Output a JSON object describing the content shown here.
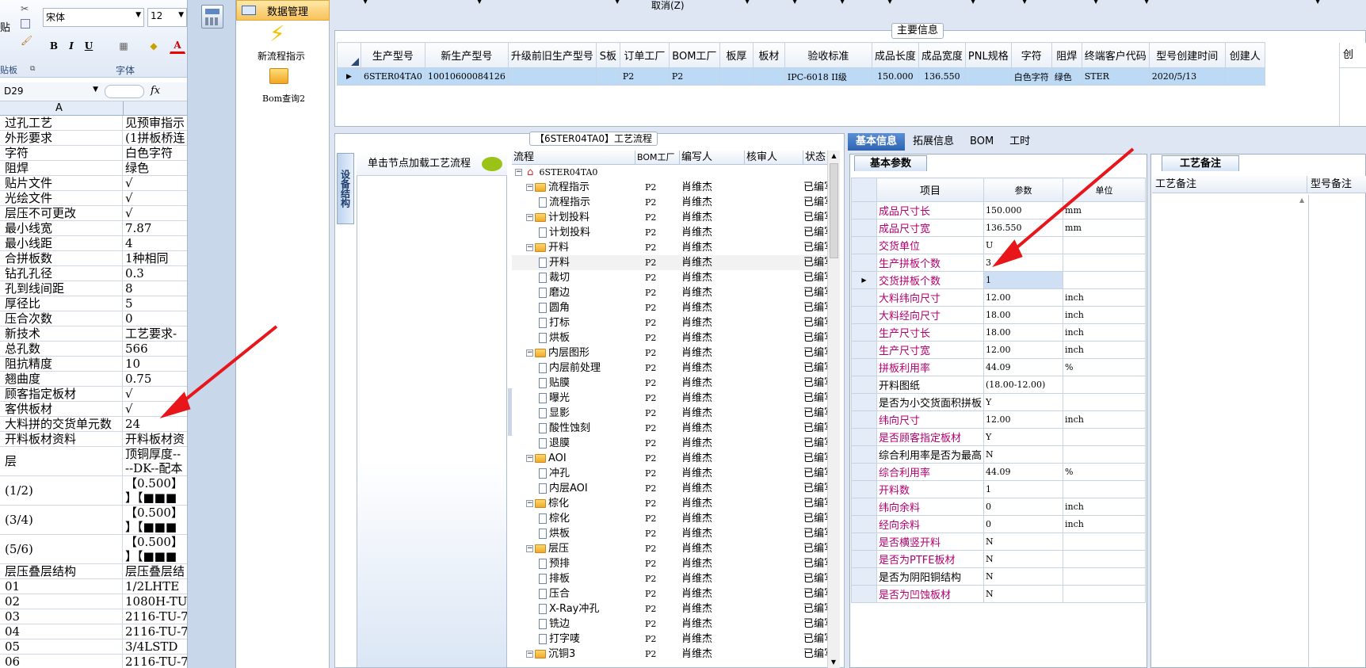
{
  "excel": {
    "font_name": "宋体",
    "font_size": "12",
    "clipboard_paste": "贴",
    "clipboard_label": "贴板",
    "font_group_label": "字体",
    "cell_ref": "D29",
    "fx": "fx",
    "column_a": "A",
    "rows": [
      {
        "a": "过孔工艺",
        "b": "见预审指示"
      },
      {
        "a": "外形要求",
        "b": "(1拼板桥连"
      },
      {
        "a": "字符",
        "b": "白色字符"
      },
      {
        "a": "阻焊",
        "b": "绿色"
      },
      {
        "a": "贴片文件",
        "b": "√"
      },
      {
        "a": "光绘文件",
        "b": "√"
      },
      {
        "a": "层压不可更改",
        "b": "√"
      },
      {
        "a": "最小线宽",
        "b": "7.87"
      },
      {
        "a": "最小线距",
        "b": "4"
      },
      {
        "a": "合拼板数",
        "b": "1种相同"
      },
      {
        "a": "钻孔孔径",
        "b": "0.3"
      },
      {
        "a": "孔到线间距",
        "b": "8"
      },
      {
        "a": "厚径比",
        "b": "5"
      },
      {
        "a": "压合次数",
        "b": "0"
      },
      {
        "a": "新技术",
        "b": "工艺要求-"
      },
      {
        "a": "总孔数",
        "b": "566"
      },
      {
        "a": "阻抗精度",
        "b": "10"
      },
      {
        "a": "翘曲度",
        "b": "0.75"
      },
      {
        "a": "顾客指定板材",
        "b": "√"
      },
      {
        "a": "客供板材",
        "b": "√"
      },
      {
        "a": "大料拼的交货单元数",
        "b": "24"
      },
      {
        "a": "开料板材资料",
        "b": "开料板材资"
      }
    ],
    "tall_rows": [
      {
        "a": "层",
        "b1": "顶铜厚度--",
        "b2": "--DK--配本"
      },
      {
        "a": "(1/2)",
        "b1": "【0.500】",
        "b2": "】【■■■"
      },
      {
        "a": "(3/4)",
        "b1": "【0.500】",
        "b2": "】【■■■"
      },
      {
        "a": "(5/6)",
        "b1": "【0.500】",
        "b2": "】【■■■"
      }
    ],
    "rows2": [
      {
        "a": "层压叠层结构",
        "b": "层压叠层结"
      },
      {
        "a": "01",
        "b": "1/2LHTE"
      },
      {
        "a": "02",
        "b": "1080H-TU-7"
      },
      {
        "a": "03",
        "b": "2116-TU-76"
      },
      {
        "a": "04",
        "b": "2116-TU-76"
      },
      {
        "a": "05",
        "b": "3/4LSTD"
      },
      {
        "a": "06",
        "b": "2116-TU-76"
      }
    ]
  },
  "nav": {
    "tab_label": "数据管理",
    "items": [
      {
        "label": "新流程指示"
      },
      {
        "label": "Bom查询2"
      }
    ]
  },
  "toolbar": {
    "cancel": "取消(Z)"
  },
  "main_info": {
    "title": "主要信息",
    "columns": [
      "生产型号",
      "新生产型号",
      "升级前旧生产型号",
      "S板",
      "订单工厂",
      "BOM工厂",
      "板厚",
      "板材",
      "验收标准",
      "成品长度",
      "成品宽度",
      "PNL规格",
      "字符",
      "阻焊",
      "终端客户代码",
      "型号创建时间",
      "创建人"
    ],
    "row": [
      "6STER04TA0",
      "10010600084126",
      "",
      "",
      "P2",
      "P2",
      "",
      "",
      "IPC-6018 II级",
      "150.000",
      "136.550",
      "",
      "白色字符",
      "绿色",
      "STER",
      "2020/5/13",
      ""
    ],
    "extra_col": "创"
  },
  "flow": {
    "title": "【6STER04TA0】工艺流程",
    "vtab": "设备结构",
    "hint": "单击节点加载工艺流程",
    "columns": [
      "流程",
      "BOM工厂",
      "编写人",
      "核审人",
      "状态"
    ],
    "root": "6STER04TA0",
    "rows": [
      {
        "name": "流程指示",
        "kind": "folder",
        "f": "P2",
        "w": "肖维杰",
        "s": "已编写"
      },
      {
        "name": "流程指示",
        "kind": "doc",
        "f": "P2",
        "w": "肖维杰",
        "s": "已编写"
      },
      {
        "name": "计划投料",
        "kind": "folder",
        "f": "P2",
        "w": "肖维杰",
        "s": "已编写"
      },
      {
        "name": "计划投料",
        "kind": "doc",
        "f": "P2",
        "w": "肖维杰",
        "s": "已编写"
      },
      {
        "name": "开料",
        "kind": "folder",
        "f": "P2",
        "w": "肖维杰",
        "s": "已编写"
      },
      {
        "name": "开料",
        "kind": "doc",
        "f": "P2",
        "w": "肖维杰",
        "s": "已编写",
        "hl": true
      },
      {
        "name": "裁切",
        "kind": "doc",
        "f": "P2",
        "w": "肖维杰",
        "s": "已编写"
      },
      {
        "name": "磨边",
        "kind": "doc",
        "f": "P2",
        "w": "肖维杰",
        "s": "已编写"
      },
      {
        "name": "圆角",
        "kind": "doc",
        "f": "P2",
        "w": "肖维杰",
        "s": "已编写"
      },
      {
        "name": "打标",
        "kind": "doc",
        "f": "P2",
        "w": "肖维杰",
        "s": "已编写"
      },
      {
        "name": "烘板",
        "kind": "doc",
        "f": "P2",
        "w": "肖维杰",
        "s": "已编写"
      },
      {
        "name": "内层图形",
        "kind": "folder",
        "f": "P2",
        "w": "肖维杰",
        "s": "已编写"
      },
      {
        "name": "内层前处理",
        "kind": "doc",
        "f": "P2",
        "w": "肖维杰",
        "s": "已编写"
      },
      {
        "name": "贴膜",
        "kind": "doc",
        "f": "P2",
        "w": "肖维杰",
        "s": "已编写"
      },
      {
        "name": "曝光",
        "kind": "doc",
        "f": "P2",
        "w": "肖维杰",
        "s": "已编写"
      },
      {
        "name": "显影",
        "kind": "doc",
        "f": "P2",
        "w": "肖维杰",
        "s": "已编写"
      },
      {
        "name": "酸性蚀刻",
        "kind": "doc",
        "f": "P2",
        "w": "肖维杰",
        "s": "已编写"
      },
      {
        "name": "退膜",
        "kind": "doc",
        "f": "P2",
        "w": "肖维杰",
        "s": "已编写"
      },
      {
        "name": "AOI",
        "kind": "folder",
        "f": "P2",
        "w": "肖维杰",
        "s": "已编写"
      },
      {
        "name": "冲孔",
        "kind": "doc",
        "f": "P2",
        "w": "肖维杰",
        "s": "已编写"
      },
      {
        "name": "内层AOI",
        "kind": "doc",
        "f": "P2",
        "w": "肖维杰",
        "s": "已编写"
      },
      {
        "name": "棕化",
        "kind": "folder",
        "f": "P2",
        "w": "肖维杰",
        "s": "已编写"
      },
      {
        "name": "棕化",
        "kind": "doc",
        "f": "P2",
        "w": "肖维杰",
        "s": "已编写"
      },
      {
        "name": "烘板",
        "kind": "doc",
        "f": "P2",
        "w": "肖维杰",
        "s": "已编写"
      },
      {
        "name": "层压",
        "kind": "folder",
        "f": "P2",
        "w": "肖维杰",
        "s": "已编写"
      },
      {
        "name": "预排",
        "kind": "doc",
        "f": "P2",
        "w": "肖维杰",
        "s": "已编写"
      },
      {
        "name": "排板",
        "kind": "doc",
        "f": "P2",
        "w": "肖维杰",
        "s": "已编写"
      },
      {
        "name": "压合",
        "kind": "doc",
        "f": "P2",
        "w": "肖维杰",
        "s": "已编写"
      },
      {
        "name": "X-Ray冲孔",
        "kind": "doc",
        "f": "P2",
        "w": "肖维杰",
        "s": "已编写"
      },
      {
        "name": "铣边",
        "kind": "doc",
        "f": "P2",
        "w": "肖维杰",
        "s": "已编写"
      },
      {
        "name": "打字唛",
        "kind": "doc",
        "f": "P2",
        "w": "肖维杰",
        "s": "已编写"
      },
      {
        "name": "沉铜3",
        "kind": "folder",
        "f": "P2",
        "w": "肖维杰",
        "s": "已编写"
      }
    ]
  },
  "right_tabs": [
    "基本信息",
    "拓展信息",
    "BOM",
    "工时"
  ],
  "basic": {
    "tab": "基本参数",
    "columns": [
      "项目",
      "参数",
      "单位"
    ],
    "rows": [
      {
        "item": "成品尺寸长",
        "val": "150.000",
        "unit": "mm",
        "pink": true
      },
      {
        "item": "成品尺寸宽",
        "val": "136.550",
        "unit": "mm",
        "pink": true
      },
      {
        "item": "交货单位",
        "val": "U",
        "unit": "",
        "pink": true
      },
      {
        "item": "生产拼板个数",
        "val": "3",
        "unit": "",
        "pink": true
      },
      {
        "item": "交货拼板个数",
        "val": "1",
        "unit": "",
        "pink": true,
        "cur": true
      },
      {
        "item": "大料纬向尺寸",
        "val": "12.00",
        "unit": "inch",
        "pink": true
      },
      {
        "item": "大料经向尺寸",
        "val": "18.00",
        "unit": "inch",
        "pink": true
      },
      {
        "item": "生产尺寸长",
        "val": "18.00",
        "unit": "inch",
        "pink": true
      },
      {
        "item": "生产尺寸宽",
        "val": "12.00",
        "unit": "inch",
        "pink": true
      },
      {
        "item": "拼板利用率",
        "val": "44.09",
        "unit": "%",
        "pink": true
      },
      {
        "item": "开料图纸",
        "val": "(18.00-12.00)",
        "unit": "",
        "pink": false
      },
      {
        "item": "是否为小交货面积拼板",
        "val": "Y",
        "unit": "",
        "pink": false
      },
      {
        "item": "纬向尺寸",
        "val": "12.00",
        "unit": "inch",
        "pink": true
      },
      {
        "item": "是否顾客指定板材",
        "val": "Y",
        "unit": "",
        "pink": true
      },
      {
        "item": "综合利用率是否为最高",
        "val": "N",
        "unit": "",
        "pink": false
      },
      {
        "item": "综合利用率",
        "val": "44.09",
        "unit": "%",
        "pink": true
      },
      {
        "item": "开料数",
        "val": "1",
        "unit": "",
        "pink": true
      },
      {
        "item": "纬向余料",
        "val": "0",
        "unit": "inch",
        "pink": true
      },
      {
        "item": "经向余料",
        "val": "0",
        "unit": "inch",
        "pink": true
      },
      {
        "item": "是否横竖开料",
        "val": "N",
        "unit": "",
        "pink": true
      },
      {
        "item": "是否为PTFE板材",
        "val": "N",
        "unit": "",
        "pink": true
      },
      {
        "item": "是否为阴阳铜结构",
        "val": "N",
        "unit": "",
        "pink": false
      },
      {
        "item": "是否为凹蚀板材",
        "val": "N",
        "unit": "",
        "pink": true
      }
    ]
  },
  "remark": {
    "tab": "工艺备注",
    "columns": [
      "工艺备注",
      "型号备注"
    ]
  },
  "colors": {
    "pink_label": "#b2006f",
    "arrow": "#e8161b",
    "selected_row": "#bcd9f5",
    "tab_active": "#2d63b2"
  }
}
